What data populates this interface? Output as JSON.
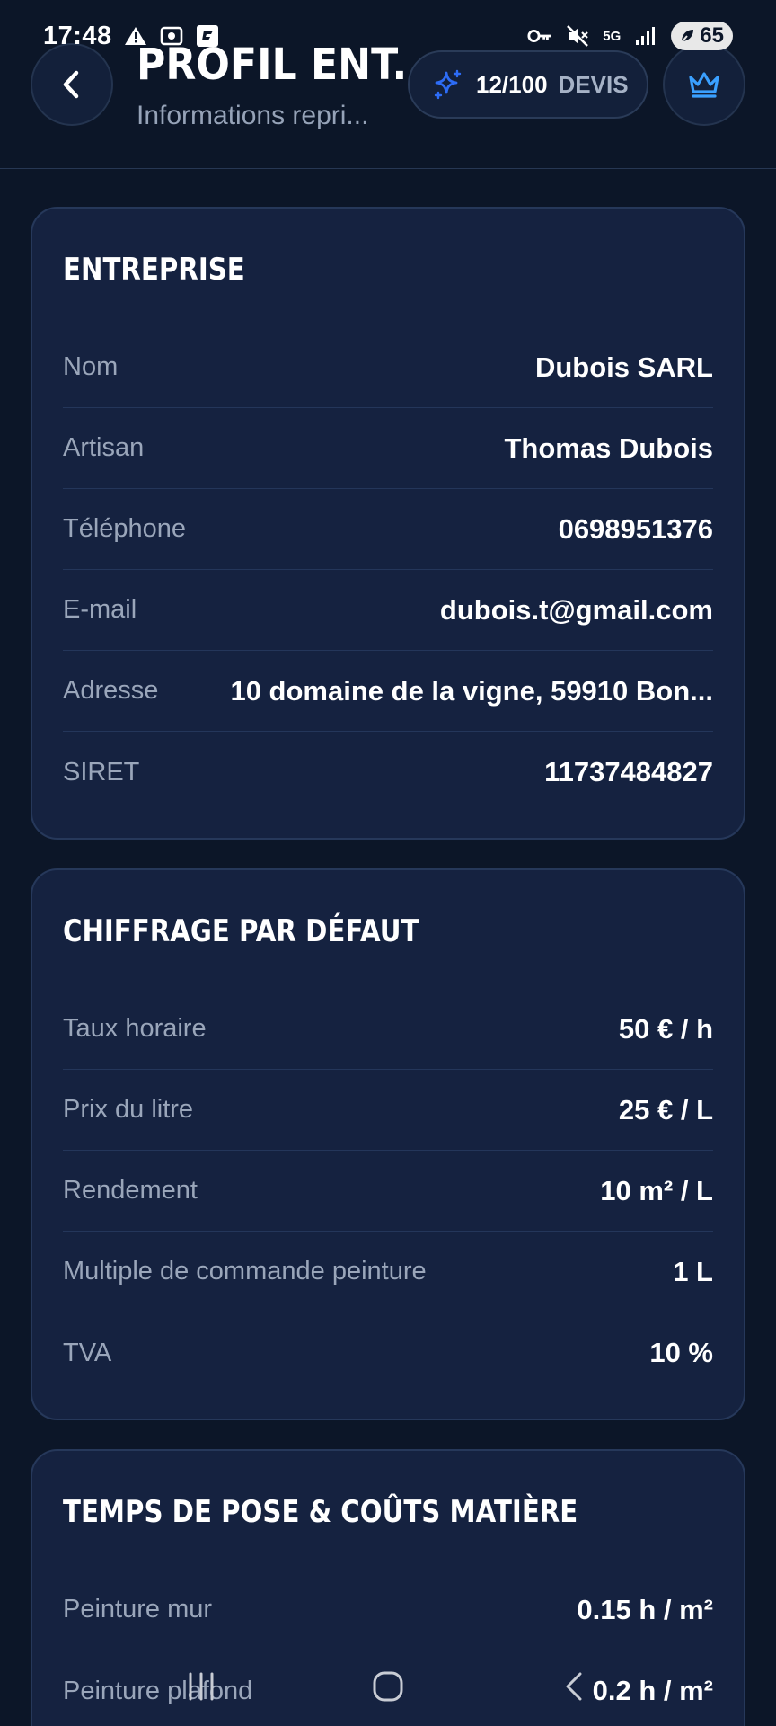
{
  "status_bar": {
    "time": "17:48",
    "network": "5G",
    "battery": "65",
    "icons": [
      "alert-icon",
      "screenshot-icon",
      "app-icon",
      "key-icon",
      "mute-icon",
      "signal-icon",
      "battery-icon"
    ]
  },
  "header": {
    "title": "PROFIL ENT...",
    "subtitle": "Informations repri...",
    "quota_count": "12/100",
    "quota_label": "DEVIS",
    "accent": "#2d6cf6",
    "crown_color": "#3aa0ff"
  },
  "entreprise": {
    "title": "ENTREPRISE",
    "rows": [
      {
        "label": "Nom",
        "value": "Dubois SARL"
      },
      {
        "label": "Artisan",
        "value": "Thomas Dubois"
      },
      {
        "label": "Téléphone",
        "value": "0698951376"
      },
      {
        "label": "E-mail",
        "value": "dubois.t@gmail.com"
      },
      {
        "label": "Adresse",
        "value": "10 domaine de la vigne, 59910 Bon..."
      },
      {
        "label": "SIRET",
        "value": "11737484827"
      }
    ]
  },
  "chiffrage": {
    "title": "CHIFFRAGE PAR DÉFAUT",
    "rows": [
      {
        "label": "Taux horaire",
        "value": "50 € / h"
      },
      {
        "label": "Prix du litre",
        "value": "25 € / L"
      },
      {
        "label": "Rendement",
        "value": "10 m² / L"
      },
      {
        "label": "Multiple de commande peinture",
        "value": "1 L"
      },
      {
        "label": "TVA",
        "value": "10 %"
      }
    ]
  },
  "temps": {
    "title": "TEMPS DE POSE & COÛTS MATIÈRE",
    "rows": [
      {
        "label": "Peinture mur",
        "value": "0.15 h / m²"
      },
      {
        "label": "Peinture plafond",
        "value": "0.2 h / m²"
      }
    ]
  }
}
